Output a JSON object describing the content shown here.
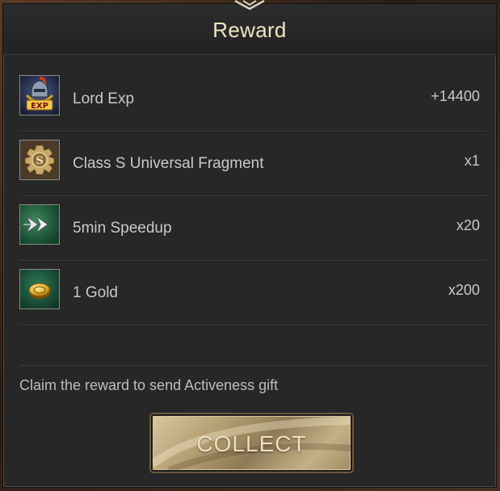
{
  "dialog": {
    "title": "Reward"
  },
  "rewards": [
    {
      "name": "Lord Exp",
      "amount": "+14400",
      "icon": "exp-helmet-icon"
    },
    {
      "name": "Class S Universal Fragment",
      "amount": "x1",
      "icon": "class-s-fragment-icon"
    },
    {
      "name": "5min Speedup",
      "amount": "x20",
      "icon": "speedup-arrows-icon"
    },
    {
      "name": "1 Gold",
      "amount": "x200",
      "icon": "gold-coin-icon"
    }
  ],
  "footer": {
    "note": "Claim the reward to send Activeness gift",
    "button_label": "COLLECT"
  },
  "exp_icon_label": "EXP",
  "fragment_icon_letter": "S",
  "colors": {
    "panel": "#272727",
    "title": "#efe6c4",
    "text": "#c9c9c9",
    "button_gold": "#b59f74"
  }
}
